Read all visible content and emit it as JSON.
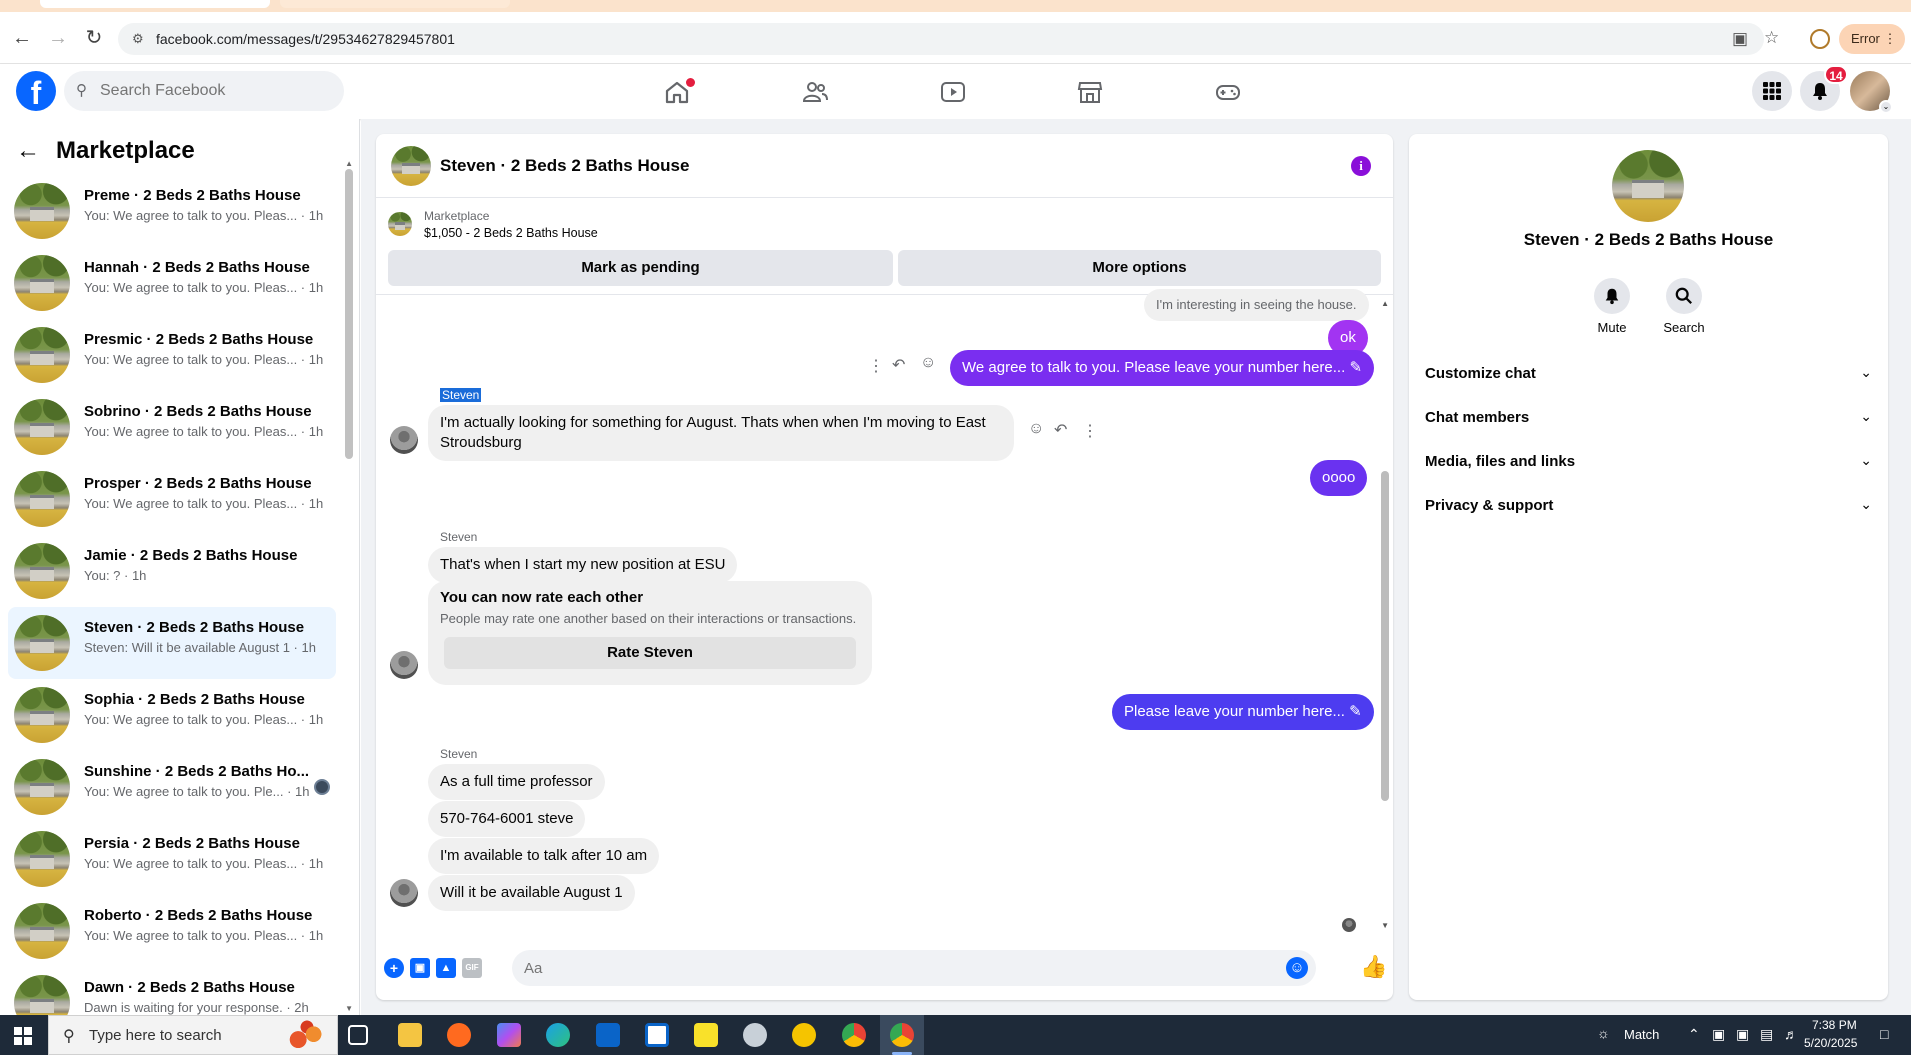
{
  "browser": {
    "url": "facebook.com/messages/t/29534627829457801",
    "error_label": "Error"
  },
  "header": {
    "logo": "f",
    "search_placeholder": "Search Facebook",
    "notifications_count": "14"
  },
  "sidebar": {
    "title": "Marketplace",
    "conversations": [
      {
        "name": "Preme · 2 Beds 2 Baths House",
        "preview": "You: We agree to talk to you. Pleas... · 1h"
      },
      {
        "name": "Hannah · 2 Beds 2 Baths House",
        "preview": "You: We agree to talk to you. Pleas... · 1h"
      },
      {
        "name": "Presmic · 2 Beds 2 Baths House",
        "preview": "You: We agree to talk to you. Pleas... · 1h"
      },
      {
        "name": "Sobrino · 2 Beds 2 Baths House",
        "preview": "You: We agree to talk to you. Pleas... · 1h"
      },
      {
        "name": "Prosper · 2 Beds 2 Baths House",
        "preview": "You: We agree to talk to you. Pleas... · 1h"
      },
      {
        "name": "Jamie · 2 Beds 2 Baths House",
        "preview": "You: ? · 1h"
      },
      {
        "name": "Steven · 2 Beds 2 Baths House",
        "preview": "Steven: Will it be available August 1 · 1h"
      },
      {
        "name": "Sophia · 2 Beds 2 Baths House",
        "preview": "You: We agree to talk to you. Pleas... · 1h"
      },
      {
        "name": "Sunshine · 2 Beds 2 Baths Ho...",
        "preview": "You: We agree to talk to you. Ple... · 1h"
      },
      {
        "name": "Persia · 2 Beds 2 Baths House",
        "preview": "You: We agree to talk to you. Pleas... · 1h"
      },
      {
        "name": "Roberto · 2 Beds 2 Baths House",
        "preview": "You: We agree to talk to you. Pleas... · 1h"
      },
      {
        "name": "Dawn · 2 Beds 2 Baths House",
        "preview": "Dawn is waiting for your response. · 2h"
      }
    ]
  },
  "chat": {
    "title": "Steven · 2 Beds 2 Baths House",
    "listing_label": "Marketplace",
    "listing_price": "$1,050 - 2 Beds 2 Baths House",
    "mark_pending": "Mark as pending",
    "more_options": "More options",
    "messages": {
      "m1": "I'm interesting in seeing the house.",
      "m2": "ok",
      "m3": "We agree to talk to you. Please leave your number here...",
      "sender1": "Steven",
      "m4a": "I'm actually looking for something for August. Thats when when I'm moving to East",
      "m4b": "Stroudsburg",
      "m5": "oooo",
      "sender2": "Steven",
      "m6": "That's when I start my new position at ESU",
      "rate_title": "You can now rate each other",
      "rate_desc": "People may rate one another based on their interactions or transactions.",
      "rate_button": "Rate Steven",
      "m7": "Please leave your number here...",
      "sender3": "Steven",
      "m8": "As a full time professor",
      "m9": "570-764-6001 steve",
      "m10": "I'm available to talk after 10 am",
      "m11": "Will it be available August 1"
    },
    "composer_placeholder": "Aa"
  },
  "right_panel": {
    "name": "Steven · 2 Beds 2 Baths House",
    "mute": "Mute",
    "search": "Search",
    "sections": [
      "Customize chat",
      "Chat members",
      "Media, files and links",
      "Privacy & support"
    ]
  },
  "taskbar": {
    "search_placeholder": "Type here to search",
    "match_label": "Match",
    "time": "7:38 PM",
    "date": "5/20/2025"
  },
  "colors": {
    "fb_blue": "#0866ff",
    "bubble_purple": "#a234f2",
    "bubble_blue": "#4d3cf0",
    "active_row": "#ebf5ff"
  }
}
